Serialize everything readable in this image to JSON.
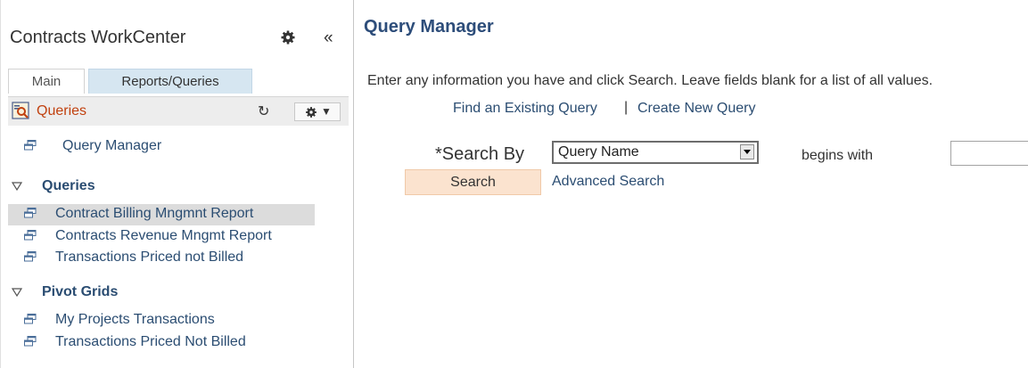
{
  "sidebar": {
    "title": "Contracts WorkCenter",
    "collapse_glyph": "«",
    "tabs": [
      {
        "label": "Main"
      },
      {
        "label": "Reports/Queries"
      }
    ],
    "pagelet": {
      "title": "Queries",
      "refresh_glyph": "↻",
      "options_caret": "▼"
    },
    "top_link": {
      "label": "Query Manager"
    },
    "sections": [
      {
        "label": "Queries",
        "items": [
          {
            "label": "Contract Billing Mngmnt Report"
          },
          {
            "label": "Contracts Revenue Mngmt Report"
          },
          {
            "label": "Transactions Priced not Billed"
          }
        ]
      },
      {
        "label": "Pivot Grids",
        "items": [
          {
            "label": "My Projects Transactions"
          },
          {
            "label": "Transactions Priced Not Billed"
          }
        ]
      }
    ]
  },
  "main": {
    "title": "Query Manager",
    "instructions": "Enter any information you have and click Search. Leave fields blank for a list of all values.",
    "find_link": "Find an Existing Query",
    "separator": "|",
    "create_link": "Create New Query",
    "search_by_label": "*Search By",
    "search_by_value": "Query Name",
    "operator_label": "begins with",
    "search_value": "",
    "search_button": "Search",
    "advanced_link": "Advanced Search"
  },
  "colors": {
    "link": "#2b4d72",
    "title": "#2d4d7a",
    "pagelet_title": "#c1410f",
    "active_tab": "#d6e6f1",
    "search_button": "#fbe3cf",
    "selected_row": "#dcdcdc"
  },
  "icons": {
    "gear": "gear-icon",
    "collapse": "double-chevron-left-icon",
    "pagelet": "query-icon",
    "refresh": "refresh-icon",
    "link_item": "window-link-icon",
    "section_toggle": "triangle-down-icon"
  }
}
